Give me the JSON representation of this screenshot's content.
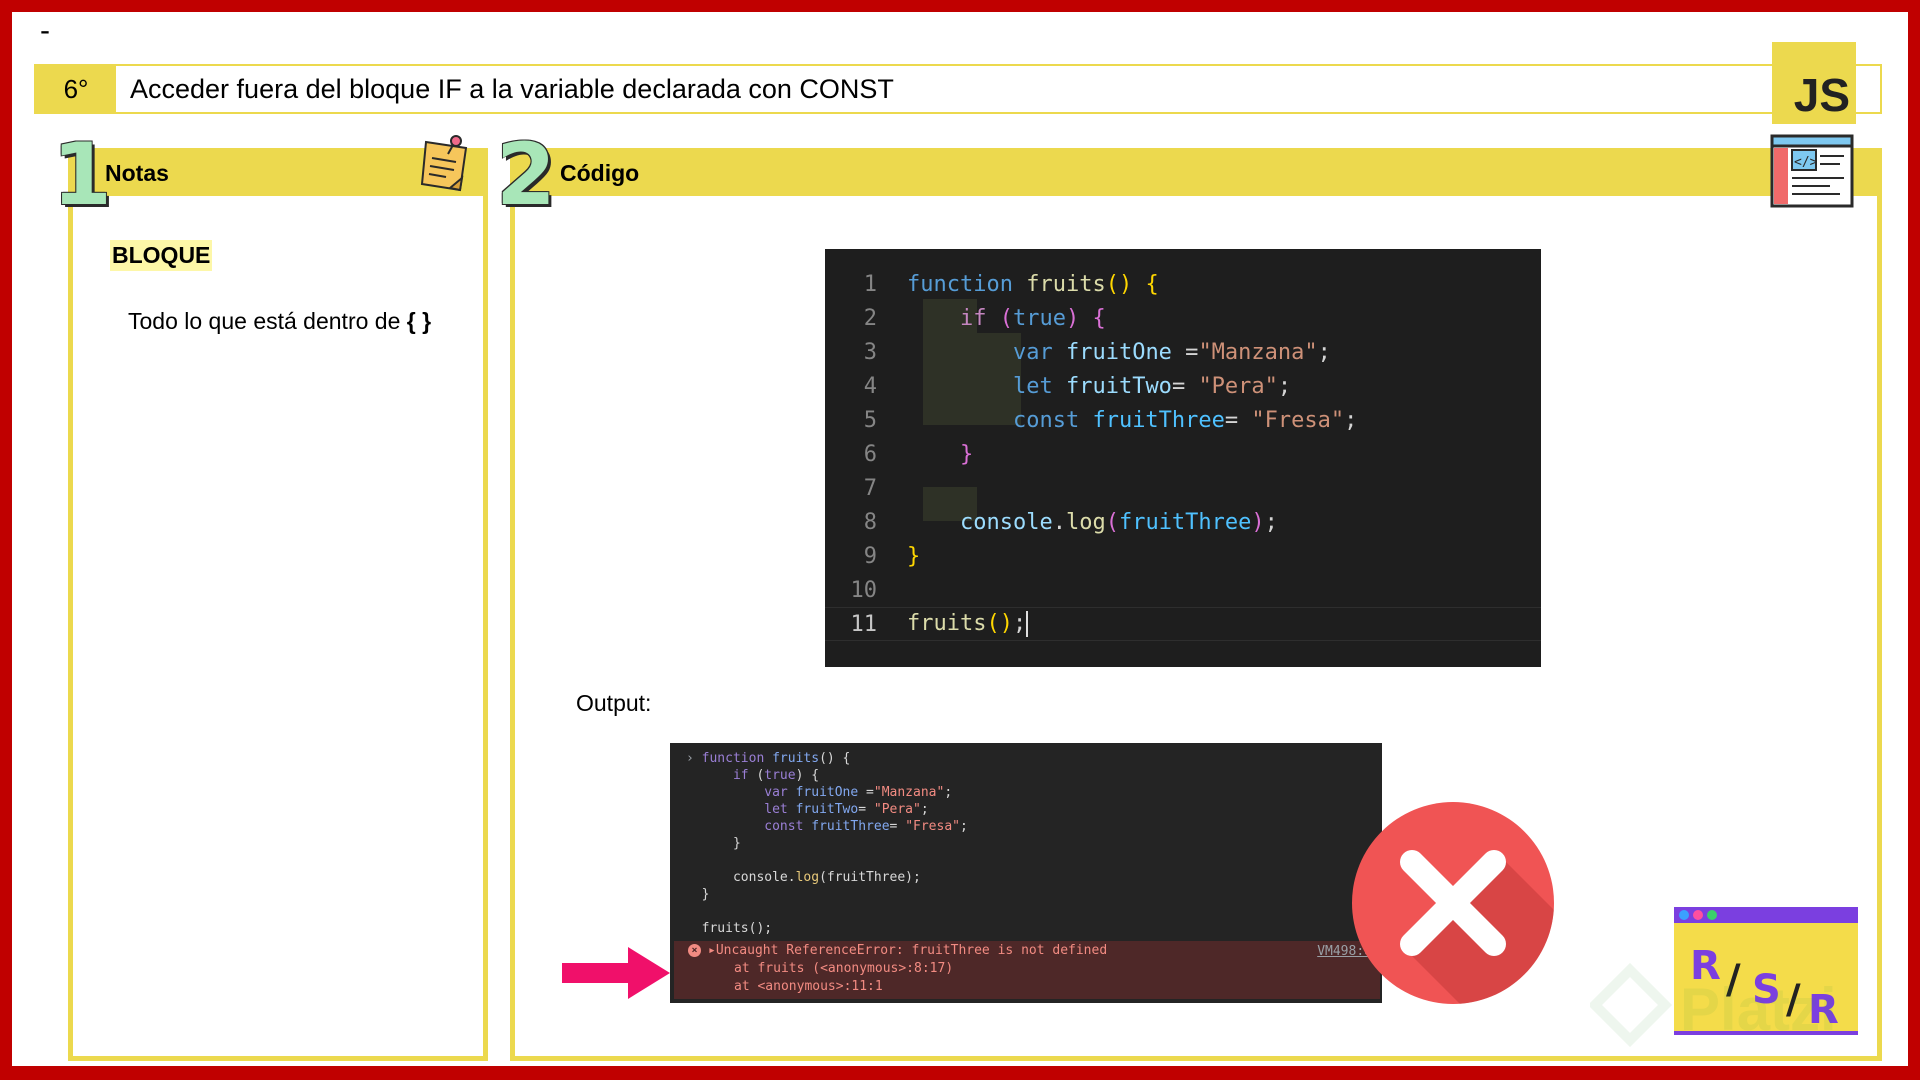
{
  "header": {
    "dash": "-",
    "number": "6°",
    "title": "Acceder fuera del bloque IF a la variable declarada con CONST",
    "badge": "JS"
  },
  "notes": {
    "section_number": "1",
    "label": "Notas",
    "term": "BLOQUE",
    "description_prefix": "Todo lo que está dentro de ",
    "description_braces": "{ }"
  },
  "code_section": {
    "section_number": "2",
    "label": "Código",
    "output_label": "Output:"
  },
  "editor": {
    "line_numbers": [
      "1",
      "2",
      "3",
      "4",
      "5",
      "6",
      "7",
      "8",
      "9",
      "10",
      "11"
    ],
    "active_line": "11"
  },
  "console": {
    "lines": [
      "function fruits() {",
      "    if (true) {",
      "        var fruitOne =\"Manzana\";",
      "        let fruitTwo= \"Pera\";",
      "        const fruitThree= \"Fresa\";",
      "    }",
      "",
      "    console.log(fruitThree);",
      "}",
      "",
      "fruits();"
    ],
    "error_message": "Uncaught ReferenceError: fruitThree is not defined",
    "stack_1": "at fruits (<anonymous>:8:17)",
    "stack_2": "at <anonymous>:11:1",
    "source_link": "VM498:8"
  },
  "logo": {
    "letters": [
      "R",
      "/",
      "S",
      "/",
      "R"
    ]
  },
  "colors": {
    "frame": "#c00000",
    "accent_yellow": "#ecd94e",
    "error_red": "#f05454",
    "arrow_pink": "#f0106a"
  }
}
